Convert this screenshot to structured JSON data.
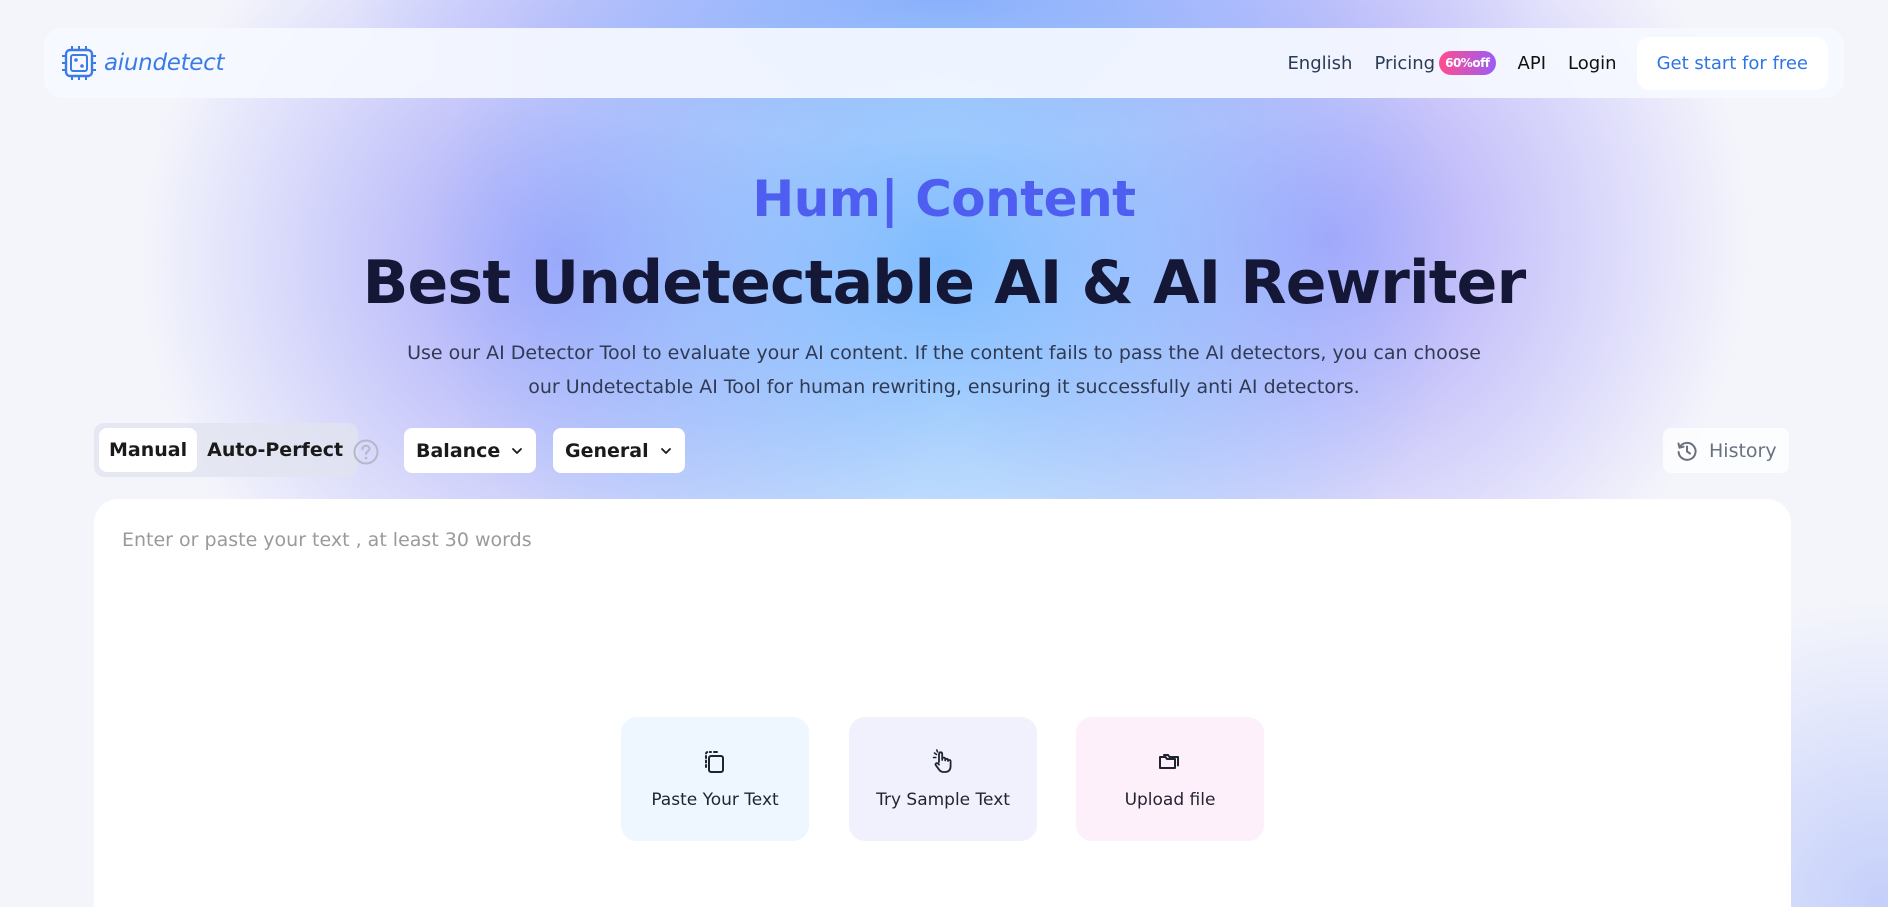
{
  "navbar": {
    "brand": "aiundetect",
    "language": "English",
    "pricing": "Pricing",
    "pricing_badge": "60%off",
    "api": "API",
    "login": "Login",
    "cta": "Get start for free"
  },
  "hero": {
    "typing_text": "Hum| Content",
    "title": "Best Undetectable AI & AI Rewriter",
    "description": "Use our AI Detector Tool to evaluate your AI content. If the content fails to pass the AI detectors, you can choose our Undetectable AI Tool for human rewriting, ensuring it successfully anti AI detectors."
  },
  "controls": {
    "mode_manual": "Manual",
    "mode_auto": "Auto-Perfect",
    "active_mode": "Manual",
    "strength": "Balance",
    "purpose": "General",
    "history": "History"
  },
  "editor": {
    "placeholder": "Enter or paste your text , at least 30 words",
    "paste": "Paste Your Text",
    "sample": "Try Sample Text",
    "upload": "Upload file"
  },
  "colors": {
    "brand": "#3b7be6",
    "accent": "#4e5ef0",
    "badge_start": "#ff4d8d",
    "badge_end": "#9b5cf6"
  },
  "icons": {
    "brand": "chip-logo-icon",
    "help": "question-circle-icon",
    "dropdown": "chevron-down-icon",
    "history": "history-clock-icon",
    "paste": "paste-clipboard-icon",
    "sample": "hand-pointer-icon",
    "upload": "folder-upload-icon"
  }
}
